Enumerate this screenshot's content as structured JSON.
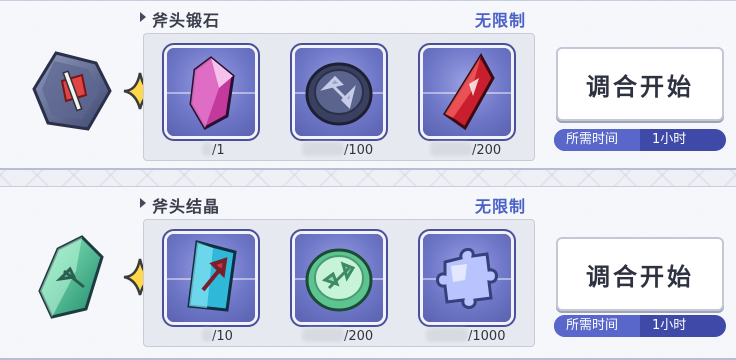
{
  "recipes": [
    {
      "title": "斧头锻石",
      "limit": "无限制",
      "materials": [
        {
          "icon": "pink-crystal-icon",
          "count": "/1"
        },
        {
          "icon": "axe-coin-dark-icon",
          "count": "/100"
        },
        {
          "icon": "red-crystal-icon",
          "count": "/200"
        }
      ],
      "button": "调合开始",
      "time_label": "所需时间",
      "time_value": "1小时"
    },
    {
      "title": "斧头结晶",
      "limit": "无限制",
      "materials": [
        {
          "icon": "axe-crystal-icon",
          "count": "/10"
        },
        {
          "icon": "axe-coin-green-icon",
          "count": "/200"
        },
        {
          "icon": "puzzle-piece-icon",
          "count": "/1000"
        }
      ],
      "button": "调合开始",
      "time_label": "所需时间",
      "time_value": "1小时"
    }
  ],
  "colors": {
    "accent": "#4a62c6",
    "slot_bg": "#6f77c8",
    "time_bar": "#3f49a8"
  }
}
